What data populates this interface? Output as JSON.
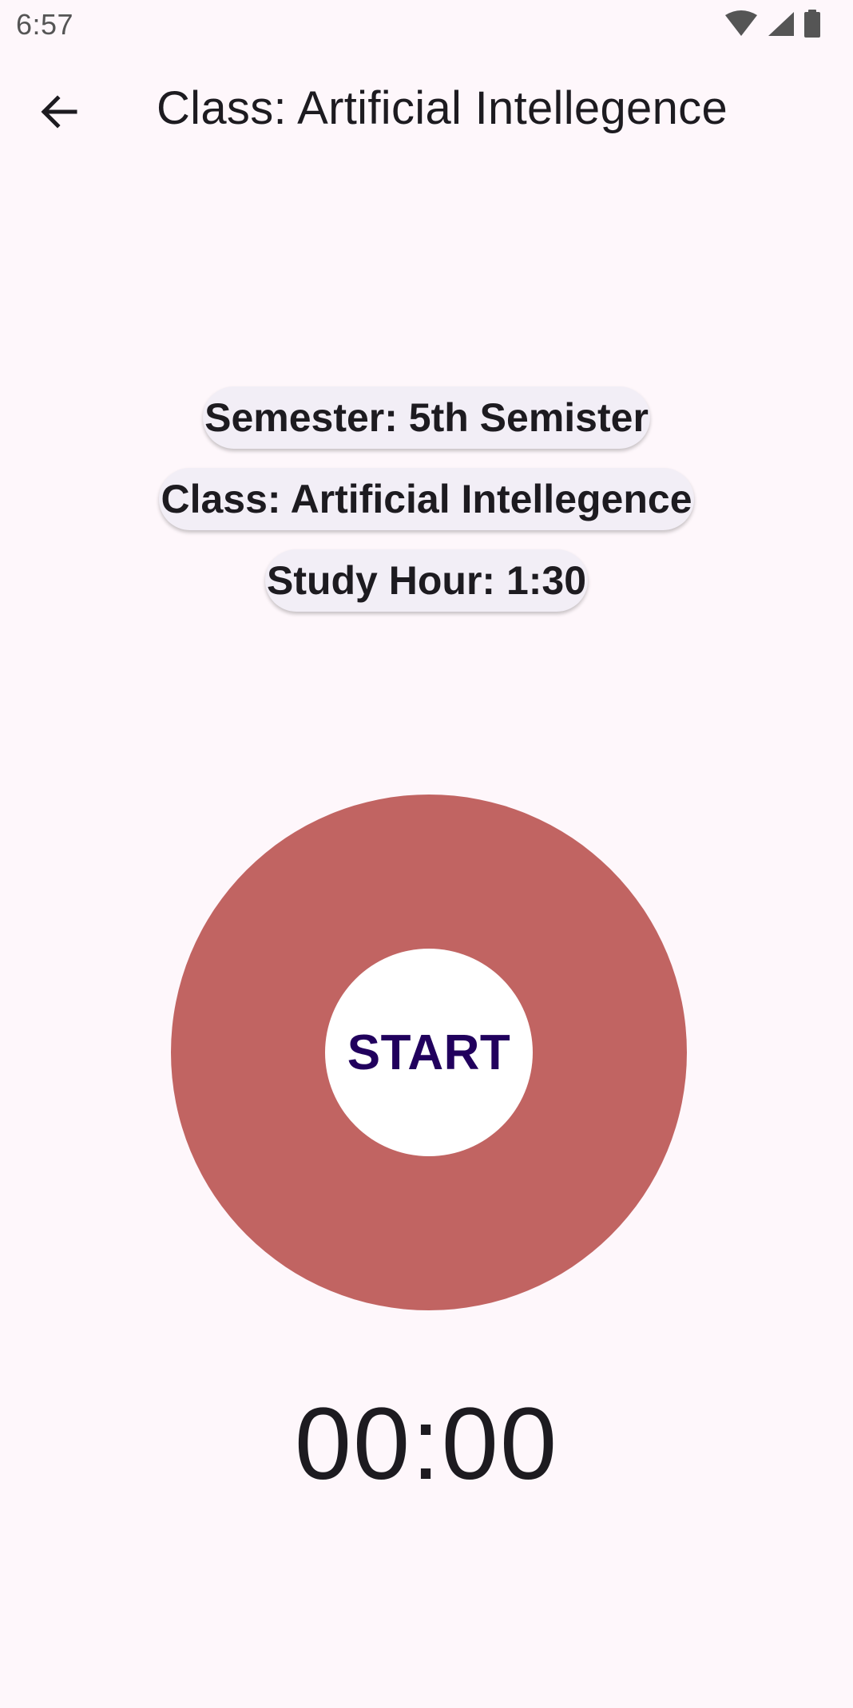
{
  "status_bar": {
    "time": "6:57",
    "icons": [
      "wifi-icon",
      "cellular-signal-icon",
      "battery-icon"
    ]
  },
  "top_bar": {
    "back_icon": "arrow-back-icon",
    "title": "Class: Artificial Intellegence"
  },
  "info": {
    "semester": "Semester: 5th Semister",
    "class": "Class: Artificial Intellegence",
    "study_hour": "Study Hour: 1:30"
  },
  "timer": {
    "start_label": "START",
    "display": "00:00"
  },
  "colors": {
    "background": "#fef7fb",
    "ring": "#c16462",
    "chip": "#f2eef6",
    "start_text": "#21005d"
  }
}
